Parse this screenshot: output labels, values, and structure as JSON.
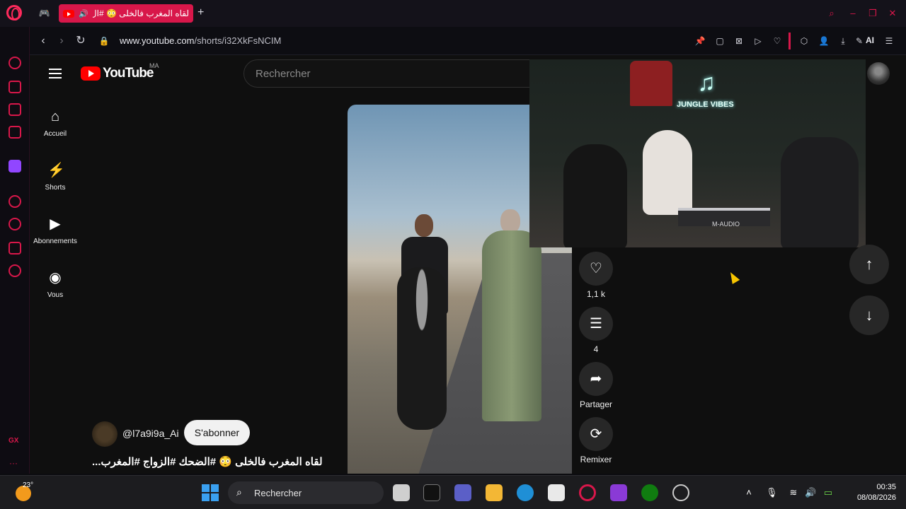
{
  "browser": {
    "tab_title": "لقاه المغرب فالخلى 😳 #ال",
    "new_tab_symbol": "+",
    "url_host": "www.youtube.com",
    "url_path": "/shorts/i32XkFsNCIM",
    "ai_label": "AI"
  },
  "youtube": {
    "wordmark": "YouTube",
    "country_code": "MA",
    "search_placeholder": "Rechercher",
    "guide": [
      {
        "label": "Accueil",
        "icon": "home-icon"
      },
      {
        "label": "Shorts",
        "icon": "shorts-icon"
      },
      {
        "label": "Abonnements",
        "icon": "subscriptions-icon"
      },
      {
        "label": "Vous",
        "icon": "you-icon"
      }
    ],
    "actions": {
      "like_count": "1,1 k",
      "comment_count": "4",
      "share_label": "Partager",
      "remix_label": "Remixer"
    },
    "channel_name": "@l7a9i9a_Ai",
    "subscribe_label": "S'abonner",
    "short_title": "لقاه المغرب فالخلى 😳 #الضحك #الزواج #المغرب...",
    "overlay_logo_text": "JUNGLE VIBES",
    "overlay_keyboard_text": "M-AUDIO"
  },
  "taskbar": {
    "temperature": "23°",
    "search_placeholder": "Rechercher",
    "time": "00:35",
    "date": "08/08/2026"
  },
  "colors": {
    "opera_accent": "#d8174a",
    "youtube_red": "#ff0000",
    "page_bg": "#0f0f0f"
  }
}
